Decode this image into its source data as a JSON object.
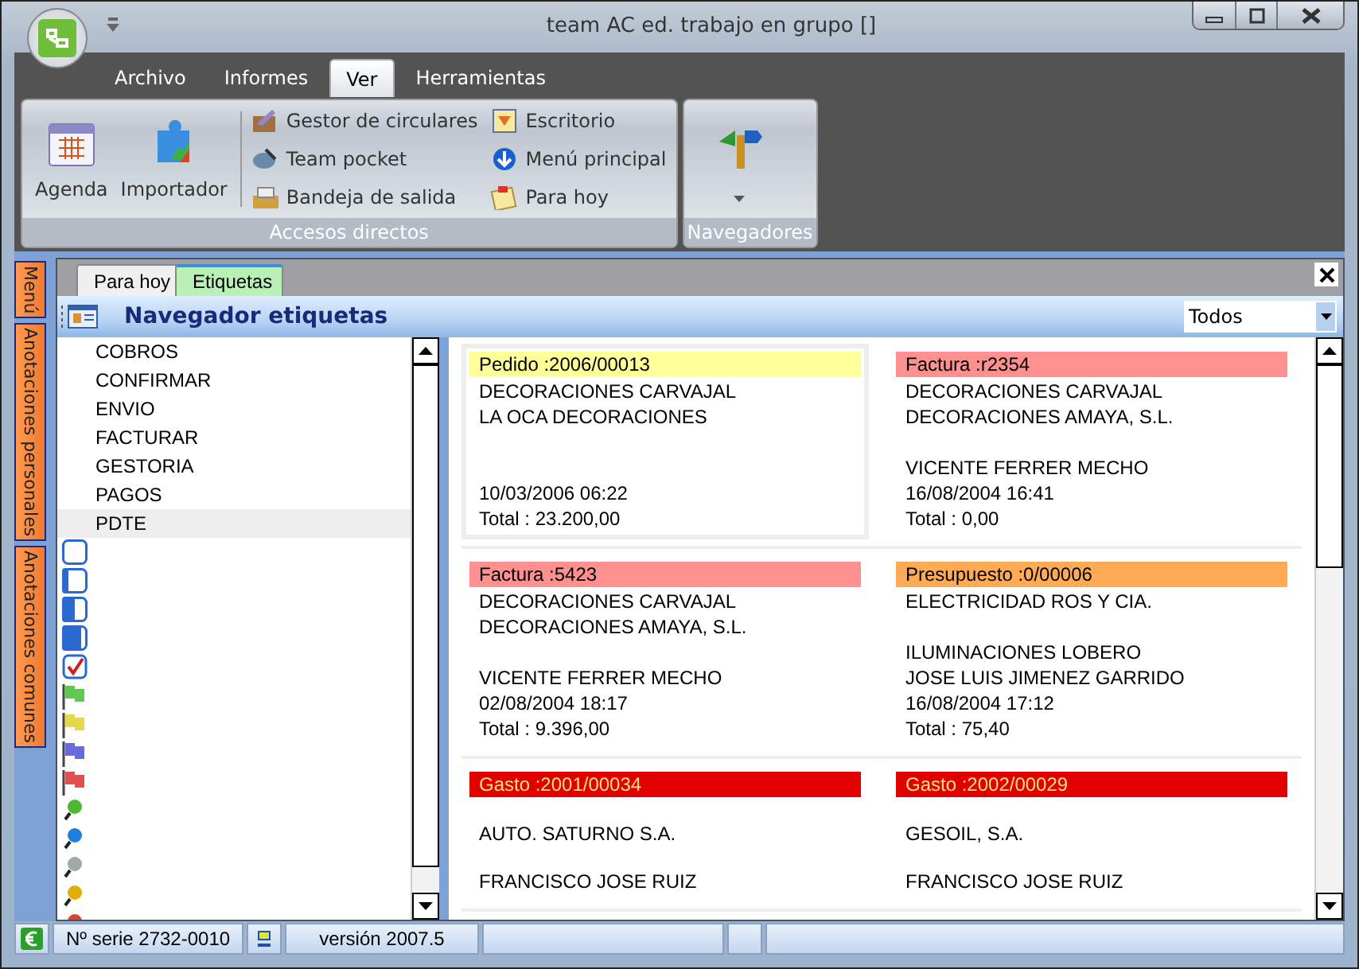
{
  "window": {
    "title": "team AC ed. trabajo en grupo []"
  },
  "ribbon": {
    "tabs": [
      {
        "label": "Archivo",
        "selected": false
      },
      {
        "label": "Informes",
        "selected": false
      },
      {
        "label": "Ver",
        "selected": true
      },
      {
        "label": "Herramientas",
        "selected": false
      }
    ],
    "groups": [
      {
        "title": "Accesos directos",
        "large": [
          "Agenda",
          "Importador"
        ],
        "small": [
          "Gestor de circulares",
          "Team pocket",
          "Bandeja de salida",
          "Escritorio",
          "Menú principal",
          "Para hoy"
        ]
      },
      {
        "title": "Navegadores"
      }
    ]
  },
  "side_tabs": [
    "Menú",
    "Anotaciones personales",
    "Anotaciones comunes"
  ],
  "doc_tabs": [
    {
      "label": "Para hoy",
      "selected": false
    },
    {
      "label": "Etiquetas",
      "selected": true
    }
  ],
  "navigator": {
    "title": "Navegador etiquetas",
    "filter": "Todos"
  },
  "labels": [
    {
      "kind": "text",
      "label": "COBROS",
      "selected": false
    },
    {
      "kind": "text",
      "label": "CONFIRMAR",
      "selected": false
    },
    {
      "kind": "text",
      "label": "ENVIO",
      "selected": false
    },
    {
      "kind": "text",
      "label": "FACTURAR",
      "selected": false
    },
    {
      "kind": "text",
      "label": "GESTORIA",
      "selected": false
    },
    {
      "kind": "text",
      "label": "PAGOS",
      "selected": false
    },
    {
      "kind": "text",
      "label": "PDTE",
      "selected": true
    },
    {
      "kind": "box"
    },
    {
      "kind": "progress",
      "level": 0.25
    },
    {
      "kind": "progress",
      "level": 0.5
    },
    {
      "kind": "progress",
      "level": 0.75
    },
    {
      "kind": "check"
    },
    {
      "kind": "flag",
      "color": "#5fc94f"
    },
    {
      "kind": "flag",
      "color": "#e6d84a"
    },
    {
      "kind": "flag",
      "color": "#6a6adf"
    },
    {
      "kind": "flag",
      "color": "#e05050"
    },
    {
      "kind": "pin",
      "color": "#4cb82e"
    },
    {
      "kind": "pin",
      "color": "#1e7fe0"
    },
    {
      "kind": "pin",
      "color": "#a0a8a8"
    },
    {
      "kind": "pin",
      "color": "#e0b000"
    },
    {
      "kind": "pin",
      "color": "#e04030"
    }
  ],
  "cards": [
    {
      "kind": "pedido",
      "selected": true,
      "title": "Pedido :2006/00013",
      "line_1": "DECORACIONES CARVAJAL",
      "line_2": "LA OCA DECORACIONES",
      "line_5": "10/03/2006 06:22",
      "line_6": "Total : 23.200,00"
    },
    {
      "kind": "factura",
      "selected": false,
      "title": "Factura :r2354",
      "line_1": "DECORACIONES CARVAJAL",
      "line_2": "DECORACIONES  AMAYA, S.L.",
      "line_4": "VICENTE FERRER MECHO",
      "line_5": "16/08/2004 16:41",
      "line_6": "Total :      0,00"
    },
    {
      "kind": "factura",
      "selected": false,
      "title": "Factura :5423",
      "line_1": "DECORACIONES CARVAJAL",
      "line_2": "DECORACIONES  AMAYA, S.L.",
      "line_4": "VICENTE FERRER MECHO",
      "line_5": "02/08/2004 18:17",
      "line_6": "Total :  9.396,00"
    },
    {
      "kind": "presupuesto",
      "selected": false,
      "title": "Presupuesto :0/00006",
      "line_1": "ELECTRICIDAD ROS Y CIA.",
      "line_3": "ILUMINACIONES LOBERO",
      "line_4": "JOSE LUIS JIMENEZ GARRIDO",
      "line_5": "16/08/2004 17:12",
      "line_6": "Total :     75,40"
    },
    {
      "kind": "gasto",
      "selected": false,
      "title": "Gasto :2001/00034",
      "line_2": "AUTO. SATURNO S.A.",
      "line_4": "FRANCISCO JOSE RUIZ"
    },
    {
      "kind": "gasto",
      "selected": false,
      "title": "Gasto :2002/00029",
      "line_2": "GESOIL, S.A.",
      "line_4": "FRANCISCO JOSE RUIZ"
    }
  ],
  "status_bar": {
    "serial": "Nº serie 2732-0010",
    "version": "versión 2007.5"
  }
}
